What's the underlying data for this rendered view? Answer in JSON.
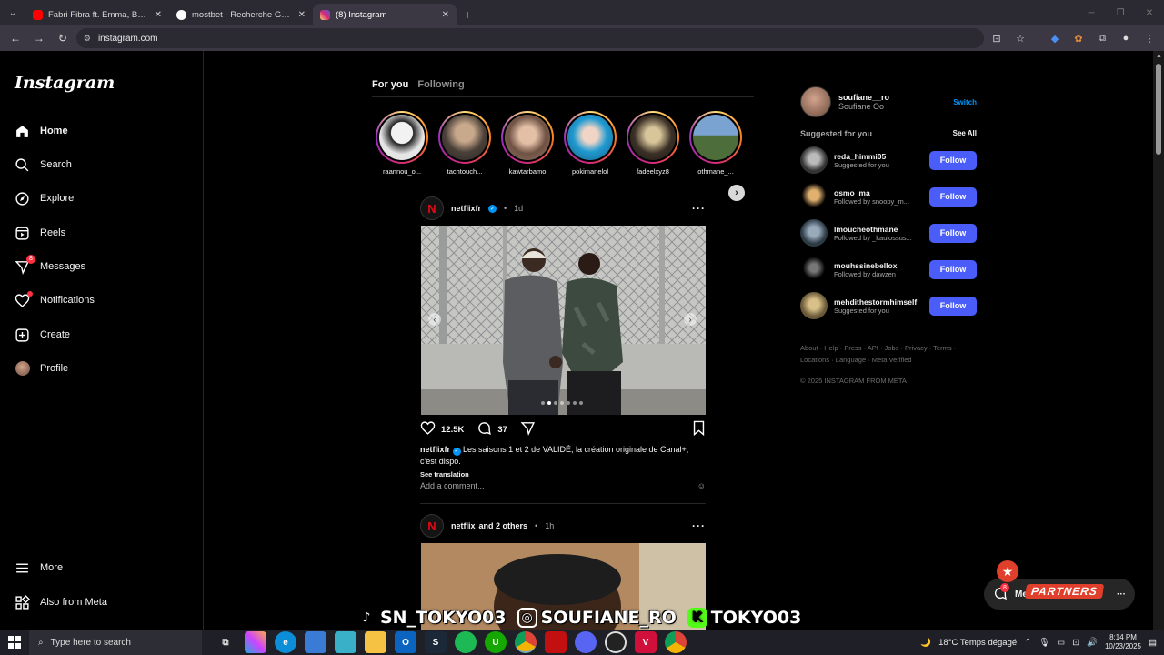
{
  "browser": {
    "tabs": [
      {
        "title": "Fabri Fibra ft. Emma, Baby Gang",
        "favicon_color": "#ff0000",
        "active": false
      },
      {
        "title": "mostbet - Recherche Google",
        "favicon_color": "#ffffff",
        "active": false
      },
      {
        "title": "(8) Instagram",
        "favicon_color": "#e1306c",
        "active": true
      }
    ],
    "url": "instagram.com"
  },
  "sidebar": {
    "logo": "Instagram",
    "items": [
      {
        "label": "Home",
        "icon": "home-icon"
      },
      {
        "label": "Search",
        "icon": "search-icon"
      },
      {
        "label": "Explore",
        "icon": "compass-icon"
      },
      {
        "label": "Reels",
        "icon": "reels-icon"
      },
      {
        "label": "Messages",
        "icon": "messages-icon",
        "badge": "8"
      },
      {
        "label": "Notifications",
        "icon": "heart-icon"
      },
      {
        "label": "Create",
        "icon": "plus-square-icon"
      },
      {
        "label": "Profile",
        "icon": "avatar"
      }
    ],
    "more": "More",
    "also_from_meta": "Also from Meta"
  },
  "feed": {
    "tabs": [
      "For you",
      "Following"
    ],
    "stories": [
      {
        "name": "raannou_o...",
        "color": "#e9e9e9"
      },
      {
        "name": "tachtouch...",
        "color": "#6b5e55"
      },
      {
        "name": "kawtarbamo",
        "color": "#a98877"
      },
      {
        "name": "pokimanelol",
        "color": "#2f7fa8"
      },
      {
        "name": "fadeelxyz8",
        "color": "#5a4a35"
      },
      {
        "name": "othmane_...",
        "color": "#6d8eb5"
      }
    ],
    "post1": {
      "user": "netflixfr",
      "time": "1d",
      "likes": "12.5K",
      "comments": "37",
      "caption_user": "netflixfr",
      "caption": "Les saisons 1 et 2 de VALIDÉ, la création originale de Canal+, c'est dispo.",
      "see_translation": "See translation",
      "add_comment": "Add a comment..."
    },
    "post2": {
      "user": "netflix",
      "others": "and 2 others",
      "time": "1h"
    }
  },
  "right_panel": {
    "username": "soufiane__ro",
    "display_name": "Soufiane Oo",
    "switch": "Switch",
    "suggested_title": "Suggested for you",
    "see_all": "See All",
    "suggestions": [
      {
        "user": "reda_himmi05",
        "sub": "Suggested for you",
        "color": "#888888"
      },
      {
        "user": "osmo_ma",
        "sub": "Followed by snoopy_m...",
        "color": "#c8a060"
      },
      {
        "user": "lmoucheothmane",
        "sub": "Followed by _kaulossus...",
        "color": "#5a7080"
      },
      {
        "user": "mouhssinebellox",
        "sub": "Followed by dawzen",
        "color": "#2a2a2a"
      },
      {
        "user": "mehdithestormhimself",
        "sub": "Suggested for you",
        "color": "#b8a070"
      }
    ],
    "follow": "Follow",
    "footer": "About · Help · Press · API · Jobs · Privacy · Terms · Locations · Language · Meta Verified",
    "copyright": "© 2025 INSTAGRAM FROM META"
  },
  "messages_pill": {
    "label": "Mes",
    "badge": "8"
  },
  "overlay": {
    "partners": "PARTNERS",
    "tiktok": "SN_TOKYO03",
    "instagram": "SOUFIANE_RO",
    "kick": "TOKYO03"
  },
  "taskbar": {
    "search": "Type here to search",
    "weather": "18°C  Temps dégagé",
    "time": "8:14 PM",
    "date": "10/23/2025"
  }
}
